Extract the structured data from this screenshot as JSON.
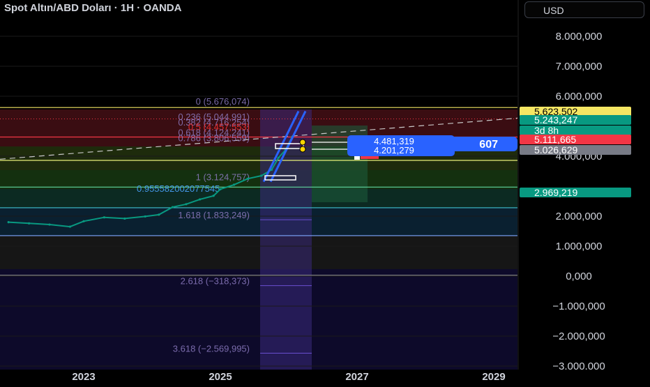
{
  "header": {
    "title": "Spot Altın/ABD Doları · 1H · OANDA",
    "currency_label": "USD"
  },
  "chart_data": {
    "type": "line",
    "title": "Spot Altın/ABD Doları · 1H · OANDA",
    "y_ticks": [
      "8.000,000",
      "7.000,000",
      "6.000,000",
      "4.000,000",
      "2.000,000",
      "1.000,000",
      "0,000",
      "−1.000,000",
      "−2.000,000",
      "−3.000,000"
    ],
    "y_tick_values": [
      8000,
      7000,
      6000,
      4000,
      2000,
      1000,
      0,
      -1000,
      -2000,
      -3000
    ],
    "ylim": [
      -3000,
      9000
    ],
    "x_ticks": [
      "2023",
      "2025",
      "2027",
      "2029"
    ],
    "x_tick_values": [
      2023,
      2025,
      2027,
      2029
    ],
    "xlim": [
      2021.9,
      2030.2
    ],
    "price_series": {
      "x": [
        2021.9,
        2022.2,
        2022.5,
        2022.8,
        2023.0,
        2023.3,
        2023.6,
        2023.9,
        2024.1,
        2024.3,
        2024.5,
        2024.7,
        2024.9,
        2025.0,
        2025.2,
        2025.4,
        2025.6,
        2025.75,
        2025.85,
        2025.95,
        2026.05
      ],
      "y": [
        1800,
        1760,
        1720,
        1650,
        1830,
        1960,
        1920,
        1990,
        2050,
        2300,
        2400,
        2560,
        2680,
        2900,
        3050,
        3250,
        3350,
        3550,
        3950,
        4200,
        4650
      ]
    },
    "price_labels": [
      {
        "text": "5.623,502",
        "value": 5623.502,
        "color": "#f5e663",
        "text_color": "#000000"
      },
      {
        "text": "5.243,247",
        "value": 5243.247,
        "color": "#089981",
        "text_color": "#ffffff"
      },
      {
        "text": "3d 8h",
        "value": 5050,
        "color": "#089981",
        "text_color": "#ffffff"
      },
      {
        "text": "5.111,665",
        "value": 4870,
        "color": "#f23645",
        "text_color": "#ffffff"
      },
      {
        "text": "5.026,629",
        "value": 4640,
        "color": "#787b86",
        "text_color": "#ffffff"
      },
      {
        "text": "2.969,219",
        "value": 2969.219,
        "color": "#089981",
        "text_color": "#ffffff"
      }
    ],
    "fib_levels": [
      {
        "ratio": "0",
        "label": "0 (5.676,074)",
        "value": 5676,
        "color": "#8e7cc3"
      },
      {
        "ratio": "0.236",
        "label": "0.236 (5.044,991)",
        "value": 5160,
        "color": "#8e7cc3"
      },
      {
        "ratio": "0.382",
        "label": "0.382 (4.716,254)",
        "value": 4980,
        "color": "#8e7cc3"
      },
      {
        "ratio": "0.5",
        "label": "0.5 (4.457,553)",
        "value": 4820,
        "color": "#ff3333"
      },
      {
        "ratio": "0.618",
        "label": "0.618 (4.124,241)",
        "value": 4640,
        "color": "#8e7cc3"
      },
      {
        "ratio": "0.786",
        "label": "0.786 (3.806,559)",
        "value": 4450,
        "color": "#8e7cc3"
      },
      {
        "ratio": "1",
        "label": "1 (3.124,757)",
        "value": 3150,
        "color": "#8e7cc3"
      },
      {
        "ratio": "1.618",
        "label": "1.618 (1.833,249)",
        "value": 1880,
        "color": "#8e7cc3"
      },
      {
        "ratio": "2.618",
        "label": "2.618 (−318,373)",
        "value": -318.373,
        "color": "#8e7cc3"
      },
      {
        "ratio": "3.618",
        "label": "3.618 (−2.569,995)",
        "value": -2569.995,
        "color": "#8e7cc3"
      }
    ],
    "horizontal_lines": [
      {
        "value": 5623.502,
        "color": "#f5e663"
      },
      {
        "value": 4640,
        "color": "#f23645"
      },
      {
        "value": 3860,
        "color": "#e9f07a"
      },
      {
        "value": 2969.219,
        "color": "#5fd6a0"
      },
      {
        "value": 2280,
        "color": "#40c0d0"
      },
      {
        "value": 1350,
        "color": "#7fa6ff"
      },
      {
        "value": 30,
        "color": "#888888"
      }
    ],
    "annotation_text": "0.955582002077545",
    "info_box": {
      "line1": "4.481,319",
      "line2": "4.201,279",
      "tail": "607"
    },
    "colors": {
      "up": "#089981",
      "down": "#f23645",
      "channel": "#2962ff",
      "fib": "#8e7cc3"
    },
    "grid": true
  }
}
